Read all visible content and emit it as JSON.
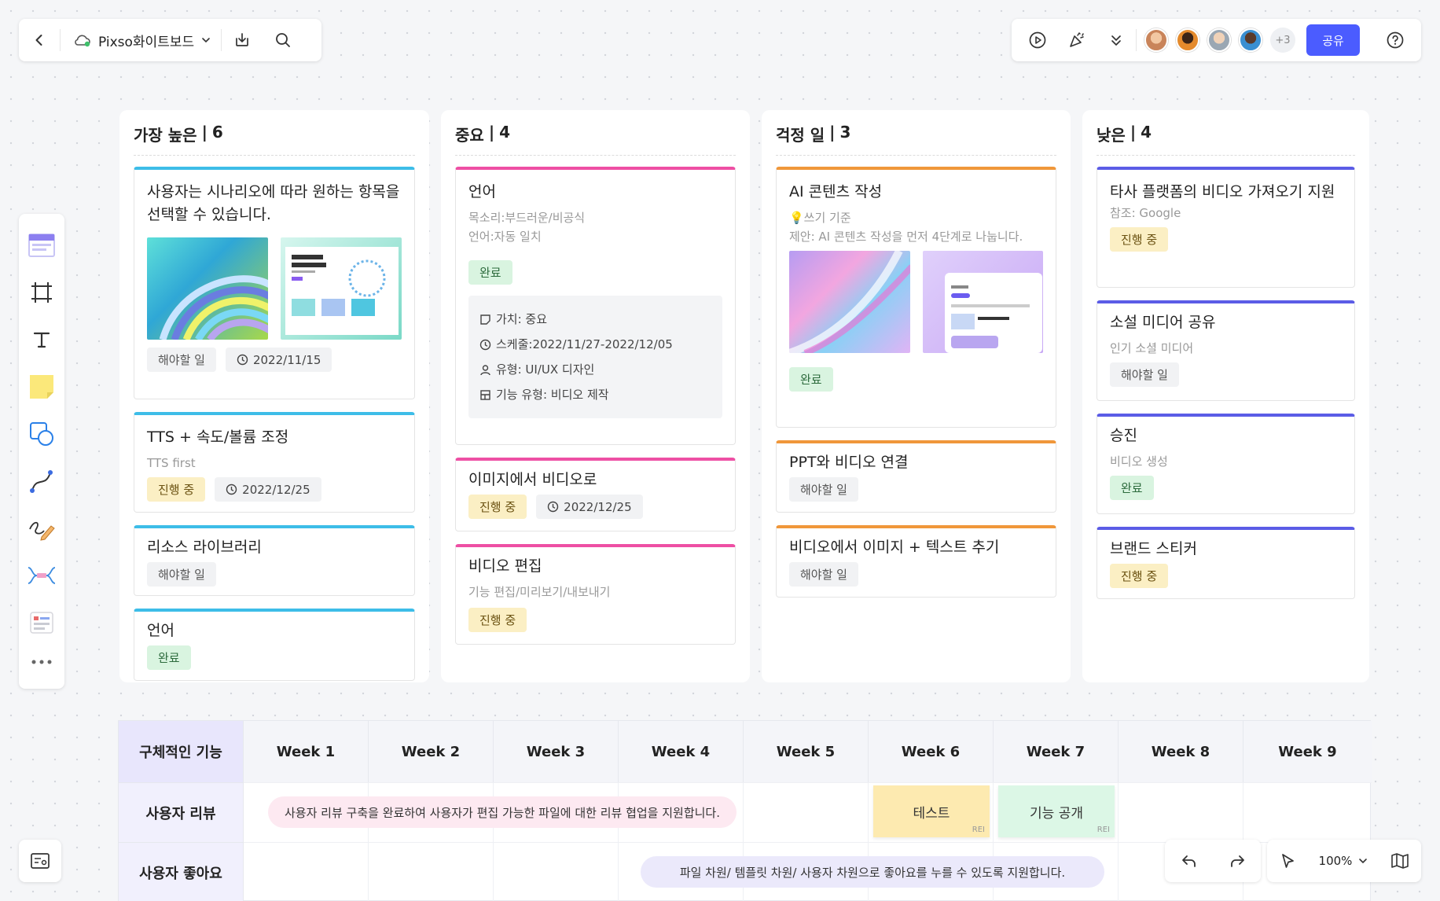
{
  "header": {
    "file_title": "Pixso화이트보드",
    "share_label": "공유",
    "more_users": "+3",
    "avatars": [
      "#c9845a",
      "#e48a2c",
      "#9aa7b3",
      "#3a8fd1"
    ]
  },
  "columns": [
    {
      "title": "가장 높은",
      "count": "6",
      "accent": "#3dbde8",
      "cards": [
        {
          "title": "사용자는 시나리오에 따라 원하는 항목을 선택할 수 있습니다.",
          "images": [
            "swirl",
            "app"
          ],
          "tags": [
            {
              "type": "todo",
              "label": "해야할 일"
            },
            {
              "type": "date",
              "label": "2022/11/15"
            }
          ]
        },
        {
          "title": "TTS + 속도/볼륨 조정",
          "sub": "TTS first",
          "tags": [
            {
              "type": "prog",
              "label": "진행 중"
            },
            {
              "type": "date",
              "label": "2022/12/25"
            }
          ]
        },
        {
          "title": "리소스 라이브러리",
          "tags": [
            {
              "type": "todo",
              "label": "해야할 일"
            }
          ]
        },
        {
          "title": "언어",
          "tags": [
            {
              "type": "done",
              "label": "완료"
            }
          ]
        }
      ]
    },
    {
      "title": "중요",
      "count": "4",
      "accent": "#ee4fa4",
      "cards": [
        {
          "title": "언어",
          "sub_lines": [
            "목소리:부드러운/비공식",
            "언어:자동 일치"
          ],
          "tags": [
            {
              "type": "done",
              "label": "완료"
            }
          ],
          "details": [
            {
              "icon": "note",
              "label": "가치: 중요"
            },
            {
              "icon": "clock",
              "label": "스케줄:2022/11/27-2022/12/05"
            },
            {
              "icon": "user",
              "label": "유형: UI/UX 디자인"
            },
            {
              "icon": "grid",
              "label": "기능 유형: 비디오 제작"
            }
          ]
        },
        {
          "title": "이미지에서 비디오로",
          "tags": [
            {
              "type": "prog",
              "label": "진행 중"
            },
            {
              "type": "date",
              "label": "2022/12/25"
            }
          ]
        },
        {
          "title": "비디오 편집",
          "sub": "기능 편집/미리보기/내보내기",
          "tags": [
            {
              "type": "prog",
              "label": "진행 중"
            }
          ]
        }
      ]
    },
    {
      "title": "걱정 일",
      "count": "3",
      "accent": "#f0973a",
      "cards": [
        {
          "title": "AI 콘텐츠 작성",
          "sub_lines": [
            "💡쓰기 기준",
            "제안: AI 콘텐츠 작성을 먼저 4단계로 나눕니다."
          ],
          "images": [
            "holo",
            "phone"
          ],
          "tags": [
            {
              "type": "done",
              "label": "완료"
            }
          ]
        },
        {
          "title": "PPT와 비디오 연결",
          "tags": [
            {
              "type": "todo",
              "label": "해야할 일"
            }
          ]
        },
        {
          "title": "비디오에서 이미지 + 텍스트 추기",
          "tags": [
            {
              "type": "todo",
              "label": "해야할 일"
            }
          ]
        }
      ]
    },
    {
      "title": "낮은",
      "count": "4",
      "accent": "#5b5ce6",
      "cards": [
        {
          "title": "타사 플랫폼의 비디오 가져오기 지원",
          "sub": "참조: Google",
          "tags": [
            {
              "type": "prog",
              "label": "진행 중"
            }
          ]
        },
        {
          "title": "소설 미디어 공유",
          "sub": "인기 소셜 미디어",
          "tags": [
            {
              "type": "todo",
              "label": "해야할 일"
            }
          ]
        },
        {
          "title": "승진",
          "sub": "비디오 생성",
          "tags": [
            {
              "type": "done",
              "label": "완료"
            }
          ]
        },
        {
          "title": "브랜드 스티커",
          "tags": [
            {
              "type": "prog",
              "label": "진행 중"
            }
          ]
        }
      ]
    }
  ],
  "timeline": {
    "corner": "구체적인 기능",
    "weeks": [
      "Week 1",
      "Week 2",
      "Week 3",
      "Week 4",
      "Week 5",
      "Week 6",
      "Week 7",
      "Week 8",
      "Week 9"
    ],
    "rows": [
      "사용자 리뷰",
      "사용자 좋아요"
    ],
    "pill_review": "사용자 리뷰 구축을 완료하여 사용자가 편집 가능한 파일에 대한 리뷰 협업을 지원합니다.",
    "pill_like": "파일 차원/ 템플릿 차원/ 사용자 차원으로 좋아요를 누를 수 있도록 지원합니다.",
    "sticky_test": "테스트",
    "sticky_release": "기능 공개",
    "sticky_author": "REI"
  },
  "zoom": "100%"
}
